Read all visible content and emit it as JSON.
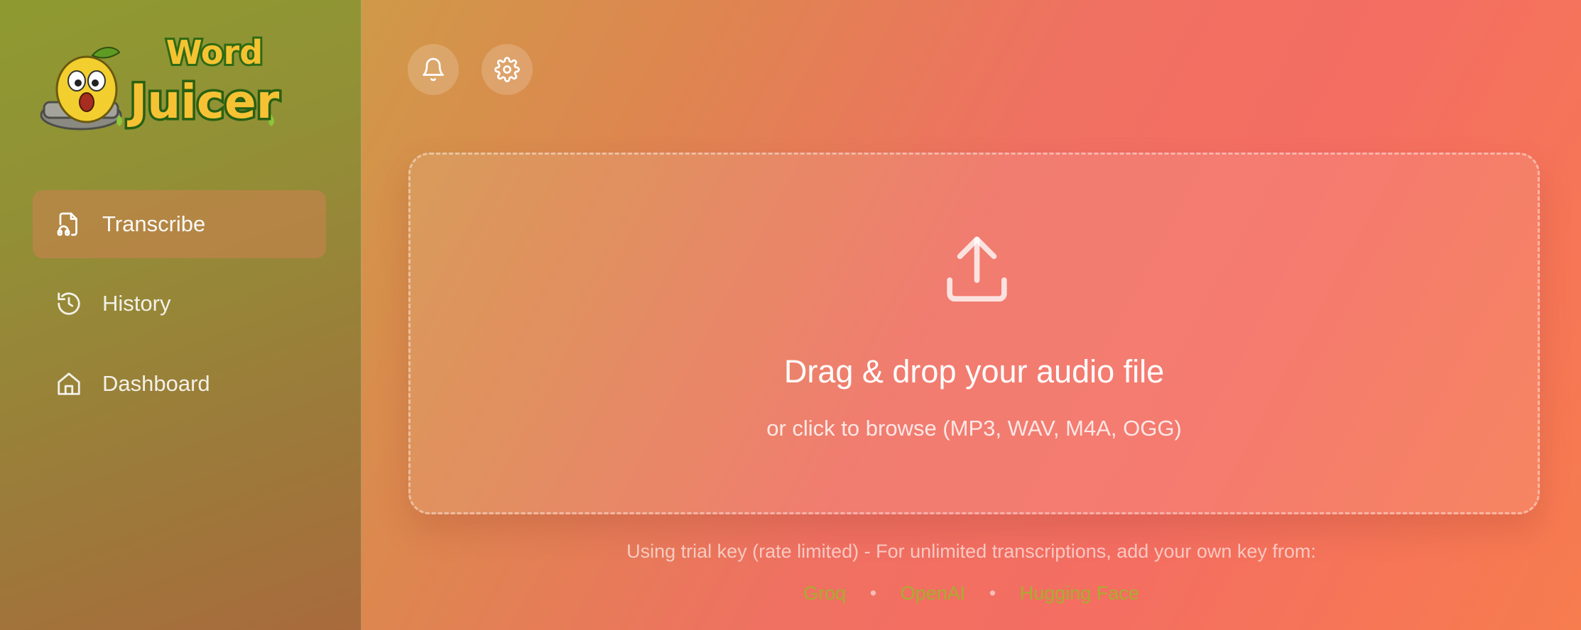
{
  "app": {
    "logo_line1": "Word",
    "logo_line2": "Juicer"
  },
  "sidebar": {
    "items": [
      {
        "label": "Transcribe",
        "icon": "file-audio-icon",
        "active": true
      },
      {
        "label": "History",
        "icon": "history-icon",
        "active": false
      },
      {
        "label": "Dashboard",
        "icon": "home-icon",
        "active": false
      }
    ]
  },
  "header": {
    "buttons": [
      {
        "icon": "bell-icon"
      },
      {
        "icon": "gear-icon"
      }
    ]
  },
  "dropzone": {
    "icon": "upload-icon",
    "title": "Drag & drop your audio file",
    "subtitle": "or click to browse (MP3, WAV, M4A, OGG)"
  },
  "footer": {
    "trial_note": "Using trial key (rate limited) - For unlimited transcriptions, add your own key from:",
    "providers": [
      {
        "label": "Groq"
      },
      {
        "label": "OpenAI"
      },
      {
        "label": "Hugging Face"
      }
    ],
    "separator": "•"
  },
  "colors": {
    "provider_link": "#a8ad2e",
    "accent_gradient_start": "#b8b040",
    "accent_gradient_end": "#f46e62"
  }
}
